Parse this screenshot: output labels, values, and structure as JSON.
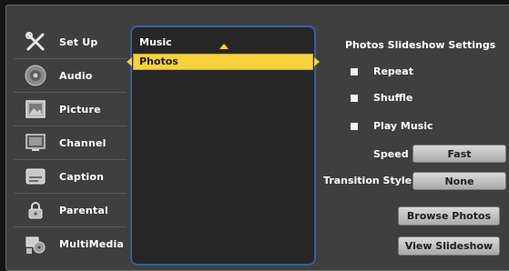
{
  "menu": {
    "items": [
      {
        "label": "Set Up",
        "icon": "tools-icon"
      },
      {
        "label": "Audio",
        "icon": "speaker-icon"
      },
      {
        "label": "Picture",
        "icon": "picture-icon"
      },
      {
        "label": "Channel",
        "icon": "tv-icon"
      },
      {
        "label": "Caption",
        "icon": "caption-icon"
      },
      {
        "label": "Parental",
        "icon": "lock-icon"
      },
      {
        "label": "MultiMedia",
        "icon": "multimedia-icon"
      }
    ]
  },
  "list": {
    "items": [
      "Music",
      "Photos"
    ],
    "selected": "Photos"
  },
  "settings": {
    "title": "Photos Slideshow Settings",
    "options": {
      "repeat": "Repeat",
      "shuffle": "Shuffle",
      "play_music": "Play Music"
    },
    "speed_label": "Speed",
    "speed_value": "Fast",
    "transition_label": "Transition Style",
    "transition_value": "None",
    "browse_button": "Browse Photos",
    "view_button": "View Slideshow"
  },
  "colors": {
    "accent": "#f6d23c",
    "panel_border": "#3c5f9a",
    "panel_bg": "#262626",
    "frame_bg": "#3f3f3f"
  }
}
